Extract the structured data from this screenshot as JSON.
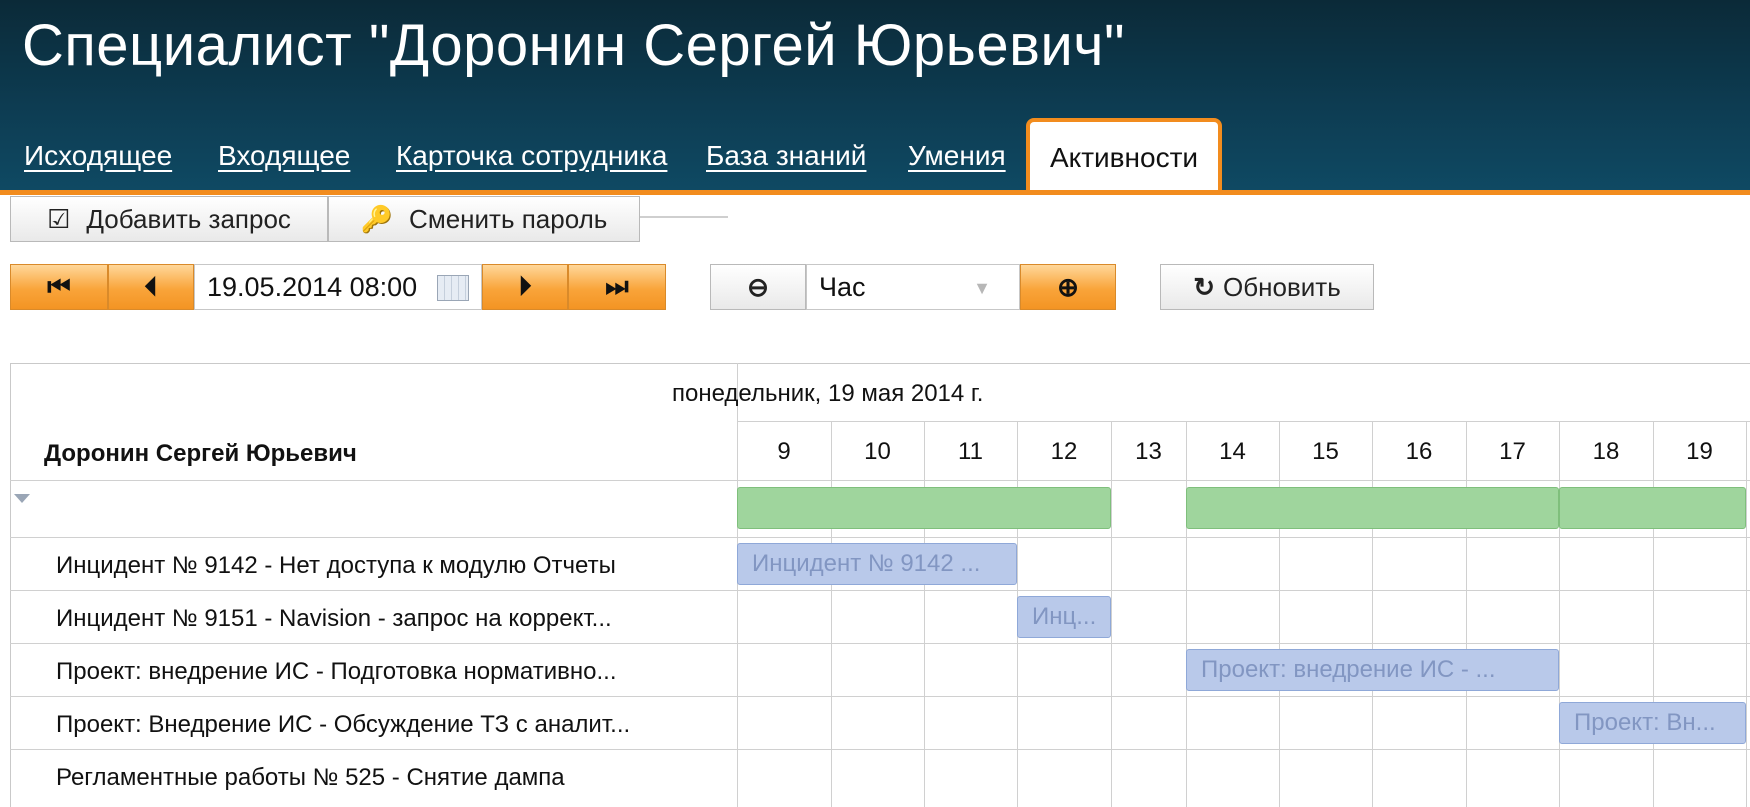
{
  "header": {
    "title": "Специалист \"Доронин Сергей Юрьевич\"",
    "tabs": [
      {
        "label": "Исходящее"
      },
      {
        "label": "Входящее"
      },
      {
        "label": "Карточка сотрудника"
      },
      {
        "label": "База знаний"
      },
      {
        "label": "Умения"
      },
      {
        "label": "Активности"
      }
    ],
    "active_tab": "Активности"
  },
  "toolbar": {
    "add_request_label": "Добавить запрос",
    "change_password_label": "Сменить пароль"
  },
  "nav": {
    "date_value": "19.05.2014 08:00",
    "scale_value": "Час",
    "refresh_label": "Обновить"
  },
  "schedule": {
    "date_header": "понедельник, 19 мая 2014 г.",
    "hours": [
      "9",
      "10",
      "11",
      "12",
      "13",
      "14",
      "15",
      "16",
      "17",
      "18",
      "19"
    ],
    "group": "Доронин Сергей Юрьевич",
    "rows": [
      {
        "label": "Инцидент № 9142 - Нет доступа к модулю Отчеты",
        "bar_text": "Инцидент № 9142 ...",
        "start": 9,
        "end": 12
      },
      {
        "label": "Инцидент № 9151 - Navision - запрос на коррект...",
        "bar_text": "Инц...",
        "start": 12,
        "end": 13
      },
      {
        "label": "Проект: внедрение ИС - Подготовка нормативно...",
        "bar_text": "Проект: внедрение ИС - ...",
        "start": 14,
        "end": 18
      },
      {
        "label": "Проект: Внедрение ИС - Обсуждение ТЗ с аналит...",
        "bar_text": "Проект: Вн...",
        "start": 18,
        "end": 20
      },
      {
        "label": "Регламентные работы № 525 - Снятие дампа",
        "bar_text": "",
        "start": null,
        "end": null
      }
    ],
    "group_bars": [
      {
        "start": 9,
        "end": 13
      },
      {
        "start": 14,
        "end": 18
      },
      {
        "start": 18,
        "end": 20
      }
    ],
    "colors": {
      "group_bar": "#9fd59d",
      "task_bar": "#b9c9ea",
      "accent": "#f28c1e"
    }
  }
}
